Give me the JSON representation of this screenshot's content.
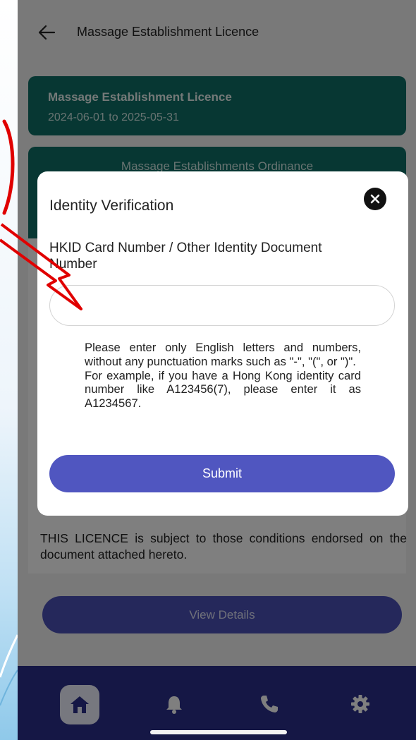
{
  "topbar": {
    "title": "Massage Establishment Licence"
  },
  "licence_card": {
    "title": "Massage Establishment Licence",
    "period": "2024-06-01 to 2025-05-31"
  },
  "ordinance_card": {
    "title": "Massage Establishments Ordinance"
  },
  "condition_text": "THIS LICENCE is subject to those conditions endorsed on the document attached hereto.",
  "view_details_label": "View Details",
  "dialog": {
    "title": "Identity Verification",
    "field_label": "HKID Card Number / Other Identity Document Number",
    "input_value": "",
    "input_placeholder": "",
    "hint_line1": "Please enter only English letters and numbers, without any punctuation marks such as \"-\", \"(\", or \")\".",
    "hint_line2": "For example, if you have a Hong Kong identity card number like A123456(7), please enter it as A1234567.",
    "submit_label": "Submit"
  },
  "bottom_nav": {
    "items": [
      {
        "icon": "home-icon",
        "active": true
      },
      {
        "icon": "bell-icon",
        "active": false
      },
      {
        "icon": "phone-icon",
        "active": false
      },
      {
        "icon": "gear-icon",
        "active": false
      }
    ]
  },
  "colors": {
    "card_teal": "#0f6e66",
    "primary_button": "#5056c0",
    "nav_bar": "#2b2f8a",
    "annotation_red": "#e00000"
  }
}
